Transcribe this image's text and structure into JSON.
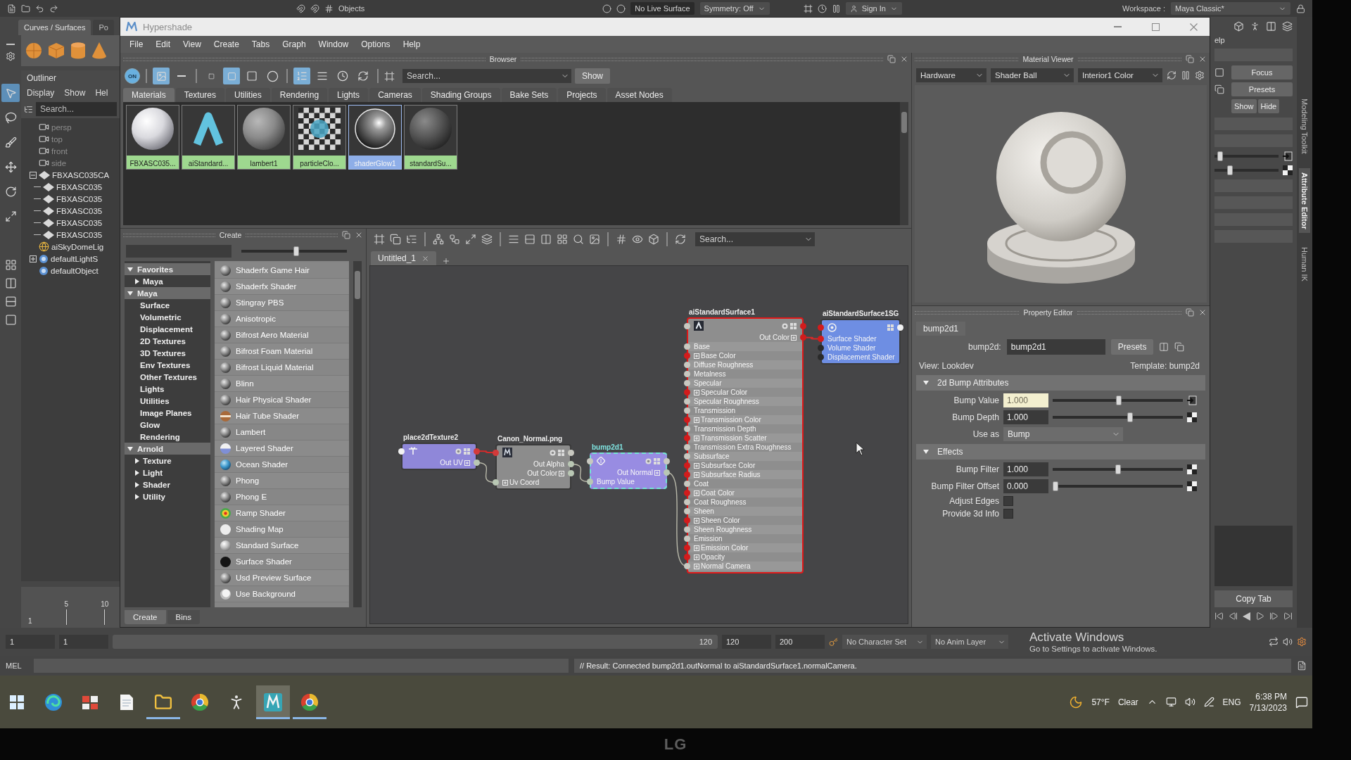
{
  "main_window": {
    "status_line": {
      "items": [
        {
          "label": "Objects",
          "kind": "label"
        },
        {
          "label": "No Live Surface",
          "kind": "field"
        },
        {
          "label": "Symmetry: Off",
          "kind": "dropdown"
        },
        {
          "label": "Sign In",
          "kind": "account"
        }
      ],
      "workspace_label": "Workspace :",
      "workspace": "Maya Classic*"
    },
    "shelf": {
      "tabs": [
        {
          "label": "Curves / Surfaces",
          "selected": true
        },
        {
          "label": "Po",
          "selected": false
        }
      ]
    },
    "toolbox": {
      "tools": [
        {
          "kind": "select",
          "selected": true
        },
        {
          "kind": "lasso",
          "selected": false
        },
        {
          "kind": "paint",
          "selected": false
        },
        {
          "kind": "move",
          "selected": false
        },
        {
          "kind": "rotate",
          "selected": false
        },
        {
          "kind": "scale",
          "selected": false
        }
      ]
    },
    "outliner": {
      "title": "Outliner",
      "menu": [
        "Display",
        "Show",
        "Hel"
      ],
      "search": {
        "placeholder": "Search..."
      },
      "items": [
        {
          "label": "persp",
          "kind": "camera",
          "dimmed": true
        },
        {
          "label": "top",
          "kind": "camera",
          "dimmed": true
        },
        {
          "label": "front",
          "kind": "camera",
          "dimmed": true
        },
        {
          "label": "side",
          "kind": "camera",
          "dimmed": true
        },
        {
          "label": "FBXASC035CA",
          "kind": "group",
          "dimmed": false,
          "expanded": true,
          "children": [
            {
              "label": "FBXASC035",
              "kind": "group",
              "dimmed": false
            },
            {
              "label": "FBXASC035",
              "kind": "group",
              "dimmed": false
            },
            {
              "label": "FBXASC035",
              "kind": "group",
              "dimmed": false
            },
            {
              "label": "FBXASC035",
              "kind": "group",
              "dimmed": false
            },
            {
              "label": "FBXASC035",
              "kind": "group",
              "dimmed": false
            }
          ]
        },
        {
          "label": "aiSkyDomeLig",
          "kind": "light",
          "dimmed": false
        },
        {
          "label": "defaultLightS",
          "kind": "set",
          "dimmed": false,
          "expanded": false
        },
        {
          "label": "defaultObject",
          "kind": "set",
          "dimmed": false
        }
      ]
    },
    "time_slider": {
      "ticks": [
        "5",
        "10"
      ],
      "frame": "1"
    },
    "range_slider": {
      "start_fields": [
        "1",
        "1"
      ],
      "range_end": "120",
      "end_fields": [
        "120",
        "200"
      ],
      "character_set": "No Character Set",
      "anim_layer": "No Anim Layer"
    },
    "command_line": {
      "language": "MEL",
      "result": "// Result: Connected bump2d1.outNormal to aiStandardSurface1.normalCamera."
    },
    "side_panel": {
      "help_fragment": "elp",
      "buttons": [
        "Focus",
        "Presets",
        "Show",
        "Hide"
      ],
      "sliders": [
        {
          "level": 0.05,
          "connected": true
        },
        {
          "level": 0.22,
          "connected": false
        }
      ],
      "copy_tab": "Copy Tab",
      "vertical_tabs": [
        {
          "label": "Modeling Toolkit",
          "selected": false
        },
        {
          "label": "Attribute Editor",
          "selected": true
        },
        {
          "label": "Human IK",
          "selected": false
        }
      ]
    }
  },
  "hypershade": {
    "title": "Hypershade",
    "menu": [
      "File",
      "Edit",
      "View",
      "Create",
      "Tabs",
      "Graph",
      "Window",
      "Options",
      "Help"
    ],
    "browser": {
      "title": "Browser",
      "render_toggle": {
        "label": "ON",
        "on": true
      },
      "view_buttons": [
        {
          "kind": "thumbnail",
          "on": true
        },
        {
          "kind": "list",
          "on": false
        },
        {
          "kind": "small",
          "on": false
        },
        {
          "kind": "medium",
          "on": true
        },
        {
          "kind": "large",
          "on": false
        },
        {
          "kind": "xlarge",
          "on": false
        },
        {
          "kind": "alpha",
          "on": true
        },
        {
          "kind": "type",
          "on": false
        },
        {
          "kind": "time",
          "on": false
        },
        {
          "kind": "swap",
          "on": false
        }
      ],
      "search": {
        "placeholder": "Search..."
      },
      "show_button": "Show",
      "tabs": [
        {
          "label": "Materials",
          "selected": true
        },
        {
          "label": "Textures",
          "selected": false
        },
        {
          "label": "Utilities",
          "selected": false
        },
        {
          "label": "Rendering",
          "selected": false
        },
        {
          "label": "Lights",
          "selected": false
        },
        {
          "label": "Cameras",
          "selected": false
        },
        {
          "label": "Shading Groups",
          "selected": false
        },
        {
          "label": "Bake Sets",
          "selected": false
        },
        {
          "label": "Projects",
          "selected": false
        },
        {
          "label": "Asset Nodes",
          "selected": false
        }
      ],
      "swatches": [
        {
          "label": "FBXASC035...",
          "kind": "white",
          "selected": false
        },
        {
          "label": "aiStandard...",
          "kind": "arnold",
          "selected": false
        },
        {
          "label": "lambert1",
          "kind": "grey",
          "selected": false
        },
        {
          "label": "particleClo...",
          "kind": "checker",
          "selected": false
        },
        {
          "label": "shaderGlow1",
          "kind": "glow",
          "selected": true
        },
        {
          "label": "standardSu...",
          "kind": "dark",
          "selected": false
        }
      ]
    },
    "material_viewer": {
      "title": "Material Viewer",
      "renderer": "Hardware",
      "geometry": "Shader Ball",
      "environment": "Interior1 Color"
    },
    "create": {
      "title": "Create",
      "icon_size": {
        "level": 0.52
      },
      "categories": [
        {
          "label": "Favorites",
          "expanded": true,
          "children": [
            {
              "label": "Maya",
              "expanded": false
            }
          ]
        },
        {
          "label": "Maya",
          "expanded": true,
          "children": [
            {
              "label": "Surface"
            },
            {
              "label": "Volumetric"
            },
            {
              "label": "Displacement"
            },
            {
              "label": "2D Textures"
            },
            {
              "label": "3D Textures"
            },
            {
              "label": "Env Textures"
            },
            {
              "label": "Other Textures"
            },
            {
              "label": "Lights"
            },
            {
              "label": "Utilities"
            },
            {
              "label": "Image Planes"
            },
            {
              "label": "Glow"
            },
            {
              "label": "Rendering"
            }
          ]
        },
        {
          "label": "Arnold",
          "expanded": true,
          "children": [
            {
              "label": "Texture",
              "expanded": false
            },
            {
              "label": "Light",
              "expanded": false
            },
            {
              "label": "Shader",
              "expanded": false
            },
            {
              "label": "Utility",
              "expanded": false
            }
          ]
        }
      ],
      "shaders": [
        {
          "label": "Shaderfx Game Hair",
          "kind": "sphere"
        },
        {
          "label": "Shaderfx Shader",
          "kind": "sphere"
        },
        {
          "label": "Stingray PBS",
          "kind": "sphere"
        },
        {
          "label": "Anisotropic",
          "kind": "sphere"
        },
        {
          "label": "Bifrost Aero Material",
          "kind": "sphere"
        },
        {
          "label": "Bifrost Foam Material",
          "kind": "sphere"
        },
        {
          "label": "Bifrost Liquid Material",
          "kind": "sphere"
        },
        {
          "label": "Blinn",
          "kind": "sphere"
        },
        {
          "label": "Hair Physical Shader",
          "kind": "sphere"
        },
        {
          "label": "Hair Tube Shader",
          "kind": "tube"
        },
        {
          "label": "Lambert",
          "kind": "sphere"
        },
        {
          "label": "Layered Shader",
          "kind": "layered"
        },
        {
          "label": "Ocean Shader",
          "kind": "ocean"
        },
        {
          "label": "Phong",
          "kind": "sphere"
        },
        {
          "label": "Phong E",
          "kind": "sphere"
        },
        {
          "label": "Ramp Shader",
          "kind": "ramp"
        },
        {
          "label": "Shading Map",
          "kind": "flat"
        },
        {
          "label": "Standard Surface",
          "kind": "light"
        },
        {
          "label": "Surface Shader",
          "kind": "black"
        },
        {
          "label": "Usd Preview Surface",
          "kind": "sphere"
        },
        {
          "label": "Use Background",
          "kind": "background"
        }
      ],
      "tabs": [
        {
          "label": "Create",
          "selected": true
        },
        {
          "label": "Bins",
          "selected": false
        }
      ]
    },
    "node_editor": {
      "tabs": [
        {
          "label": "Untitled_1",
          "selected": true
        }
      ],
      "search": {
        "placeholder": "Search..."
      },
      "nodes": [
        {
          "name": "place2dTexture2",
          "kind": "place2d",
          "selected": false,
          "highlighted": false,
          "header_ports": [
            {
              "kind": "in",
              "color": "#f2f2f2"
            },
            {
              "kind": "out",
              "color": "#d23a3a"
            }
          ],
          "ports": [
            {
              "label": "Out UV",
              "kind": "out",
              "expandable": true,
              "color": "#b9c7b4"
            }
          ]
        },
        {
          "name": "Canon_Normal.png",
          "kind": "file",
          "selected": false,
          "highlighted": false,
          "header_ports": [
            {
              "kind": "in",
              "color": "#d23a3a"
            },
            {
              "kind": "out",
              "color": "#c8c8c0"
            }
          ],
          "ports": [
            {
              "label": "Out Alpha",
              "kind": "out",
              "expandable": false,
              "color": "#b9c7b4"
            },
            {
              "label": "Out Color",
              "kind": "out",
              "expandable": true,
              "color": "#b9c7b4"
            },
            {
              "label": "Uv Coord",
              "kind": "in",
              "expandable": true,
              "color": "#b9c7b4"
            }
          ]
        },
        {
          "name": "bump2d1",
          "kind": "bump",
          "selected": true,
          "highlighted": false,
          "header_ports": [
            {
              "kind": "in",
              "color": "#c8c8c0"
            },
            {
              "kind": "out",
              "color": "#c8c8c0"
            }
          ],
          "ports": [
            {
              "label": "Out Normal",
              "kind": "out",
              "expandable": true,
              "color": "#b9c7b4"
            },
            {
              "label": "Bump Value",
              "kind": "in",
              "expandable": false,
              "color": "#b9c7b4"
            }
          ]
        },
        {
          "name": "aiStandardSurface1",
          "kind": "arnold",
          "selected": false,
          "highlighted": true,
          "header_ports": [
            {
              "kind": "in",
              "color": "#c8c8c0"
            },
            {
              "kind": "out",
              "color": "#d21c1c"
            }
          ],
          "ports": [
            {
              "label": "Out Color",
              "kind": "out",
              "expandable": true,
              "color": "#d21c1c"
            },
            {
              "label": "Base",
              "kind": "in",
              "expandable": false,
              "color": "#c8c8c0"
            },
            {
              "label": "Base Color",
              "kind": "in",
              "expandable": true,
              "color": "#d21c1c"
            },
            {
              "label": "Diffuse Roughness",
              "kind": "in",
              "expandable": false,
              "color": "#c8c8c0"
            },
            {
              "label": "Metalness",
              "kind": "in",
              "expandable": false,
              "color": "#c8c8c0"
            },
            {
              "label": "Specular",
              "kind": "in",
              "expandable": false,
              "color": "#c8c8c0"
            },
            {
              "label": "Specular Color",
              "kind": "in",
              "expandable": true,
              "color": "#d21c1c"
            },
            {
              "label": "Specular Roughness",
              "kind": "in",
              "expandable": false,
              "color": "#c8c8c0"
            },
            {
              "label": "Transmission",
              "kind": "in",
              "expandable": false,
              "color": "#c8c8c0"
            },
            {
              "label": "Transmission Color",
              "kind": "in",
              "expandable": true,
              "color": "#d21c1c"
            },
            {
              "label": "Transmission Depth",
              "kind": "in",
              "expandable": false,
              "color": "#c8c8c0"
            },
            {
              "label": "Transmission Scatter",
              "kind": "in",
              "expandable": true,
              "color": "#d21c1c"
            },
            {
              "label": "Transmission Extra Roughness",
              "kind": "in",
              "expandable": false,
              "color": "#c8c8c0"
            },
            {
              "label": "Subsurface",
              "kind": "in",
              "expandable": false,
              "color": "#c8c8c0"
            },
            {
              "label": "Subsurface Color",
              "kind": "in",
              "expandable": true,
              "color": "#d21c1c"
            },
            {
              "label": "Subsurface Radius",
              "kind": "in",
              "expandable": true,
              "color": "#d21c1c"
            },
            {
              "label": "Coat",
              "kind": "in",
              "expandable": false,
              "color": "#c8c8c0"
            },
            {
              "label": "Coat Color",
              "kind": "in",
              "expandable": true,
              "color": "#d21c1c"
            },
            {
              "label": "Coat Roughness",
              "kind": "in",
              "expandable": false,
              "color": "#c8c8c0"
            },
            {
              "label": "Sheen",
              "kind": "in",
              "expandable": false,
              "color": "#c8c8c0"
            },
            {
              "label": "Sheen Color",
              "kind": "in",
              "expandable": true,
              "color": "#d21c1c"
            },
            {
              "label": "Sheen Roughness",
              "kind": "in",
              "expandable": false,
              "color": "#c8c8c0"
            },
            {
              "label": "Emission",
              "kind": "in",
              "expandable": false,
              "color": "#c8c8c0"
            },
            {
              "label": "Emission Color",
              "kind": "in",
              "expandable": true,
              "color": "#d21c1c"
            },
            {
              "label": "Opacity",
              "kind": "in",
              "expandable": true,
              "color": "#d21c1c"
            },
            {
              "label": "Normal Camera",
              "kind": "in",
              "expandable": true,
              "color": "#c8c8c0"
            }
          ]
        },
        {
          "name": "aiStandardSurface1SG",
          "kind": "shading-group",
          "selected": false,
          "highlighted": false,
          "header_ports": [
            {
              "kind": "in",
              "color": "#d21c1c"
            },
            {
              "kind": "out",
              "color": "#f2f2f2"
            }
          ],
          "ports": [
            {
              "label": "Surface Shader",
              "kind": "in",
              "expandable": false,
              "color": "#d21c1c"
            },
            {
              "label": "Volume Shader",
              "kind": "in",
              "expandable": false,
              "color": "#2a2a2a"
            },
            {
              "label": "Displacement Shader",
              "kind": "in",
              "expandable": false,
              "color": "#2a2a2a"
            }
          ]
        }
      ]
    },
    "property_editor": {
      "title": "Property Editor",
      "tab": "bump2d1",
      "type_label": "bump2d:",
      "name": "bump2d1",
      "presets": "Presets",
      "view": "View: Lookdev",
      "template": "Template: bump2d",
      "sections": [
        {
          "title": "2d Bump Attributes",
          "expanded": true,
          "rows": [
            {
              "kind": "slider",
              "label": "Bump Value",
              "value": "1.000",
              "level": 0.51,
              "connected": true
            },
            {
              "kind": "slider",
              "label": "Bump Depth",
              "value": "1.000",
              "level": 0.6,
              "connected": false
            },
            {
              "kind": "dropdown",
              "label": "Use as",
              "value": "Bump"
            }
          ]
        },
        {
          "title": "Effects",
          "expanded": true,
          "rows": [
            {
              "kind": "slider",
              "label": "Bump Filter",
              "value": "1.000",
              "level": 0.5,
              "connected": false
            },
            {
              "kind": "slider",
              "label": "Bump Filter Offset",
              "value": "0.000",
              "level": 0,
              "connected": false
            },
            {
              "kind": "checkbox",
              "label": "Adjust Edges",
              "checked": false
            },
            {
              "kind": "checkbox",
              "label": "Provide 3d Info",
              "checked": false
            }
          ]
        }
      ]
    }
  },
  "taskbar": {
    "apps": [
      {
        "kind": "start",
        "running": false,
        "active": false
      },
      {
        "kind": "edge",
        "running": false,
        "active": false
      },
      {
        "kind": "tiles",
        "running": false,
        "active": false
      },
      {
        "kind": "notepad",
        "running": false,
        "active": false
      },
      {
        "kind": "explorer",
        "running": true,
        "active": false
      },
      {
        "kind": "chrome",
        "running": false,
        "active": false
      },
      {
        "kind": "figure",
        "running": false,
        "active": false
      },
      {
        "kind": "maya",
        "running": true,
        "active": true
      },
      {
        "kind": "chrome",
        "running": true,
        "active": false
      }
    ],
    "weather": {
      "temperature": "57°F",
      "condition": "Clear"
    },
    "language": "ENG",
    "time": "6:38 PM",
    "date": "7/13/2023"
  },
  "activation_notice": {
    "title": "Activate Windows",
    "text": "Go to Settings to activate Windows."
  },
  "monitor": {
    "logo": "LG"
  }
}
